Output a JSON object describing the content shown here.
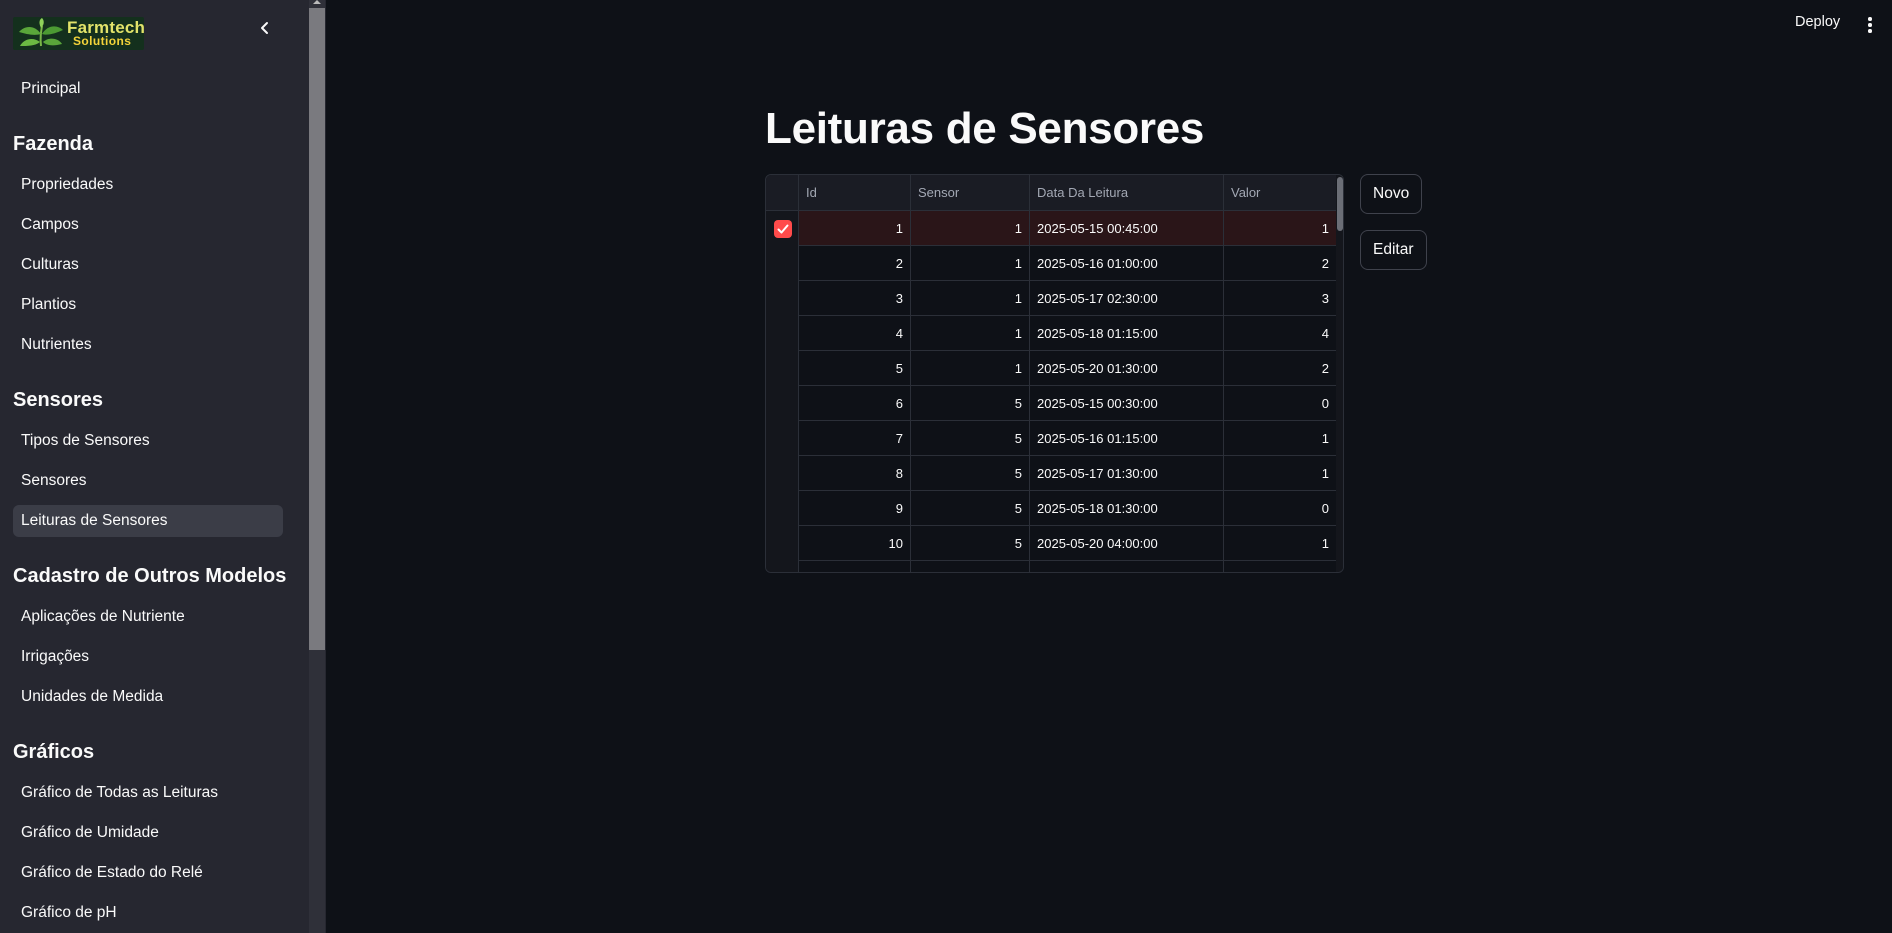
{
  "app": {
    "logo_title": "Farmtech",
    "logo_subtitle": "Solutions"
  },
  "topbar": {
    "deploy_label": "Deploy"
  },
  "sidebar": {
    "items": [
      {
        "label": "Principal",
        "type": "link"
      },
      {
        "label": "Fazenda",
        "type": "section"
      },
      {
        "label": "Propriedades",
        "type": "link"
      },
      {
        "label": "Campos",
        "type": "link"
      },
      {
        "label": "Culturas",
        "type": "link"
      },
      {
        "label": "Plantios",
        "type": "link"
      },
      {
        "label": "Nutrientes",
        "type": "link"
      },
      {
        "label": "Sensores",
        "type": "section"
      },
      {
        "label": "Tipos de Sensores",
        "type": "link"
      },
      {
        "label": "Sensores",
        "type": "link"
      },
      {
        "label": "Leituras de Sensores",
        "type": "link",
        "active": true
      },
      {
        "label": "Cadastro de Outros Modelos",
        "type": "section"
      },
      {
        "label": "Aplicações de Nutriente",
        "type": "link"
      },
      {
        "label": "Irrigações",
        "type": "link"
      },
      {
        "label": "Unidades de Medida",
        "type": "link"
      },
      {
        "label": "Gráficos",
        "type": "section"
      },
      {
        "label": "Gráfico de Todas as Leituras",
        "type": "link"
      },
      {
        "label": "Gráfico de Umidade",
        "type": "link"
      },
      {
        "label": "Gráfico de Estado do Relé",
        "type": "link"
      },
      {
        "label": "Gráfico de pH",
        "type": "link"
      }
    ]
  },
  "main": {
    "title": "Leituras de Sensores",
    "buttons": {
      "new_label": "Novo",
      "edit_label": "Editar"
    },
    "table": {
      "columns": [
        "Id",
        "Sensor",
        "Data Da Leitura",
        "Valor"
      ],
      "rows": [
        {
          "id": "1",
          "sensor": "1",
          "date": "2025-05-15 00:45:00",
          "value": "1",
          "selected": true
        },
        {
          "id": "2",
          "sensor": "1",
          "date": "2025-05-16 01:00:00",
          "value": "2"
        },
        {
          "id": "3",
          "sensor": "1",
          "date": "2025-05-17 02:30:00",
          "value": "3"
        },
        {
          "id": "4",
          "sensor": "1",
          "date": "2025-05-18 01:15:00",
          "value": "4"
        },
        {
          "id": "5",
          "sensor": "1",
          "date": "2025-05-20 01:30:00",
          "value": "2"
        },
        {
          "id": "6",
          "sensor": "5",
          "date": "2025-05-15 00:30:00",
          "value": "0"
        },
        {
          "id": "7",
          "sensor": "5",
          "date": "2025-05-16 01:15:00",
          "value": "1"
        },
        {
          "id": "8",
          "sensor": "5",
          "date": "2025-05-17 01:30:00",
          "value": "1"
        },
        {
          "id": "9",
          "sensor": "5",
          "date": "2025-05-18 01:30:00",
          "value": "0"
        },
        {
          "id": "10",
          "sensor": "5",
          "date": "2025-05-20 04:00:00",
          "value": "1"
        }
      ]
    }
  },
  "colors": {
    "accent": "#ff4b4b",
    "sidebar_bg": "#262730",
    "main_bg": "#0e1117"
  }
}
